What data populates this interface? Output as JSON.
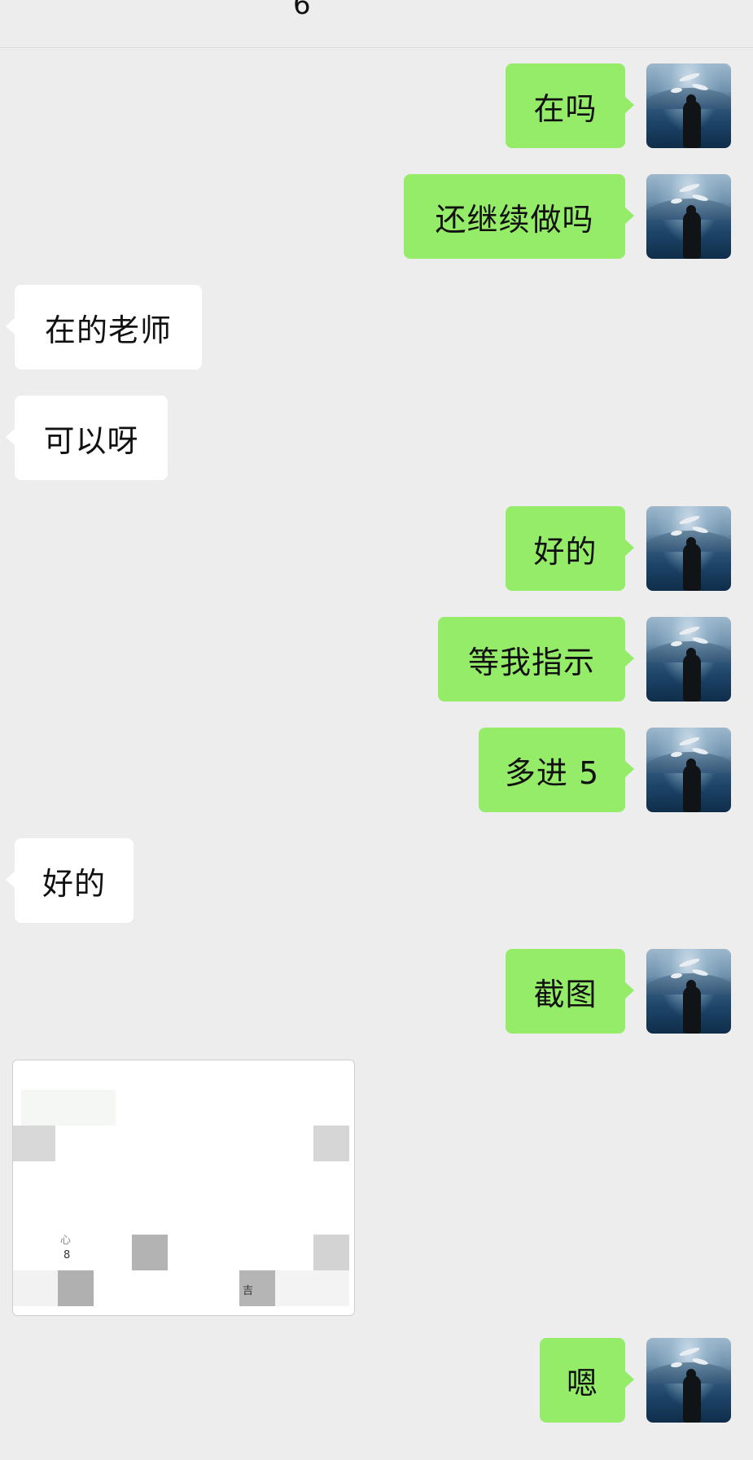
{
  "header": {
    "title": "6"
  },
  "messages": [
    {
      "from": "me",
      "text": "在吗"
    },
    {
      "from": "me",
      "text": "还继续做吗"
    },
    {
      "from": "them",
      "text": "在的老师"
    },
    {
      "from": "them",
      "text": "可以呀"
    },
    {
      "from": "me",
      "text": "好的"
    },
    {
      "from": "me",
      "text": "等我指示"
    },
    {
      "from": "me",
      "text": "多进 5"
    },
    {
      "from": "them",
      "text": "好的"
    },
    {
      "from": "me",
      "text": "截图"
    },
    {
      "from": "them",
      "type": "image",
      "visible_text": [
        "8",
        "吉",
        "心"
      ]
    },
    {
      "from": "me",
      "text": "嗯"
    }
  ],
  "colors": {
    "background": "#ededed",
    "my_bubble": "#95ec69",
    "their_bubble": "#ffffff"
  },
  "icons": {
    "avatar": "avatar-seagull-photo"
  }
}
